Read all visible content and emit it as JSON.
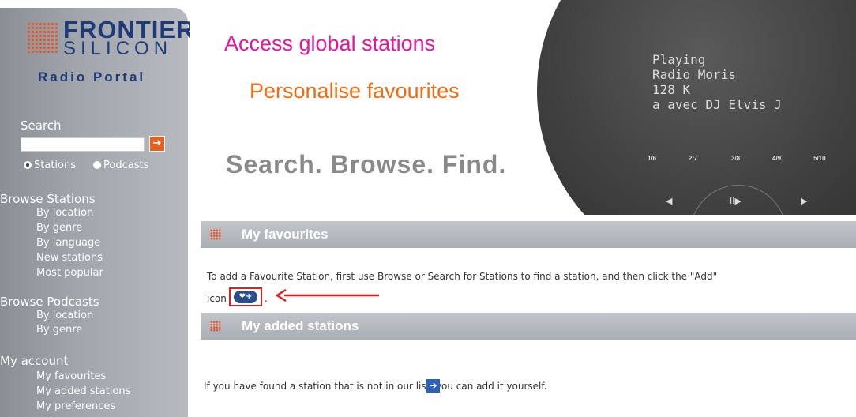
{
  "sidebar": {
    "logo": {
      "brand_top": "FRONTIER",
      "brand_bottom": "SILICON",
      "product": "Radio Portal"
    },
    "search": {
      "label": "Search",
      "value": "",
      "go_icon": "arrow-right-icon",
      "options": [
        {
          "label": "Stations",
          "selected": true
        },
        {
          "label": "Podcasts",
          "selected": false
        }
      ]
    },
    "browse_stations": {
      "heading": "Browse Stations",
      "items": [
        "By location",
        "By genre",
        "By language",
        "New stations",
        "Most popular"
      ]
    },
    "browse_podcasts": {
      "heading": "Browse Podcasts",
      "items": [
        "By location",
        "By genre"
      ]
    },
    "my_account": {
      "heading": "My account",
      "items": [
        "My favourites",
        "My added stations",
        "My preferences"
      ]
    }
  },
  "banner": {
    "tagline_1": "Access global stations",
    "tagline_2": "Personalise favourites",
    "tagline_3": "Search. Browse. Find.",
    "lcd_lines": [
      "Playing",
      "Radio Moris",
      "128 K",
      "a avec DJ Elvis J"
    ],
    "presets": [
      "1/6",
      "2/7",
      "3/8",
      "4/9",
      "5/10"
    ],
    "controls": [
      "◀",
      "II▶",
      "▶"
    ]
  },
  "favourites": {
    "title": "My favourites",
    "instruction": "To add a Favourite Station, first use Browse or Search for Stations to find a station, and then    click the \"Add\"",
    "instruction_icon_prefix": "icon",
    "instruction_suffix": ".",
    "add_icon_label": "❤+"
  },
  "added_stations": {
    "title": "My added stations",
    "text": "If you have found a station that is not in our list, you can add it yourself.",
    "go_icon": "arrow-right-icon"
  },
  "colors": {
    "brand_blue": "#1e3a7a",
    "accent_orange": "#e8601f",
    "tagline_pink": "#e0199d",
    "tagline_orange": "#f36b12",
    "annotation_red": "#e02020"
  }
}
